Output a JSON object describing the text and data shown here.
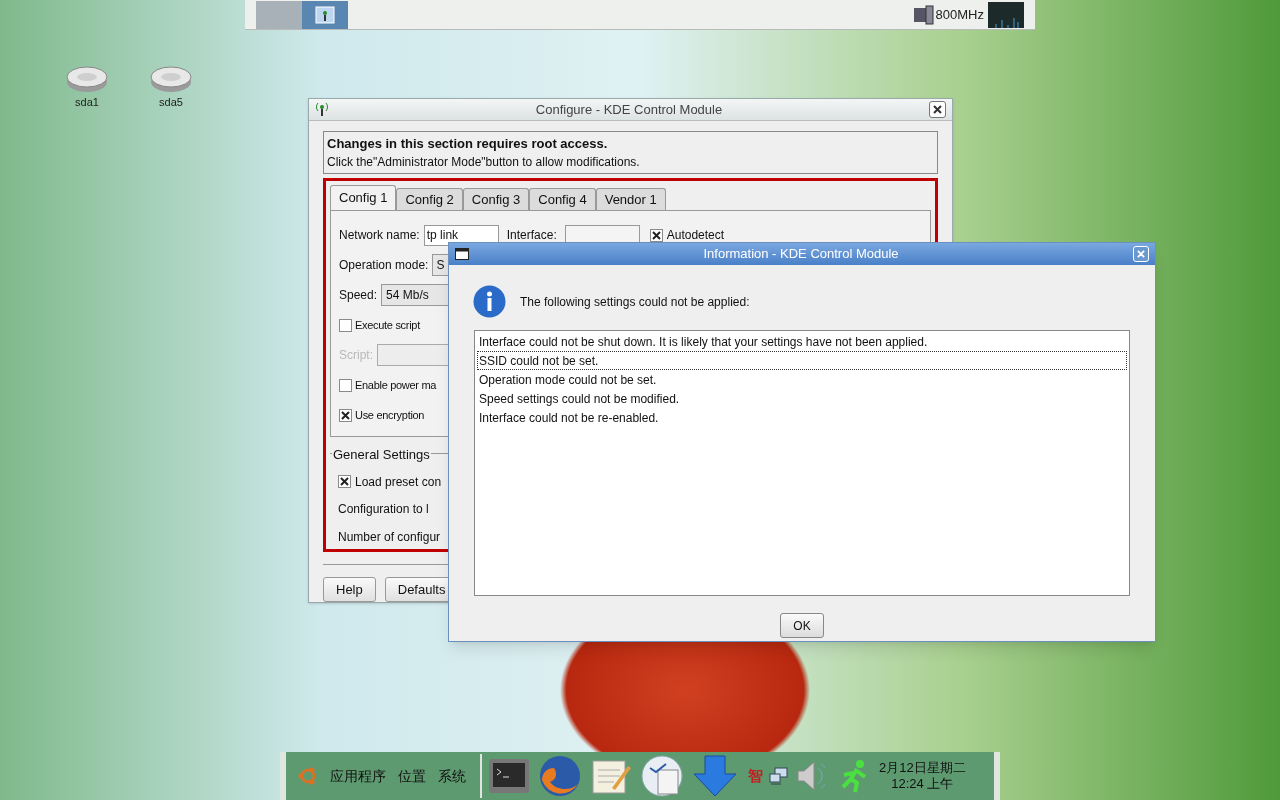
{
  "top_panel": {
    "workspaces": [
      {
        "selected": false
      },
      {
        "selected": true
      }
    ],
    "cpu_frequency": "800MHz"
  },
  "desktop_icons": [
    {
      "label": "sda1"
    },
    {
      "label": "sda5"
    }
  ],
  "config_window": {
    "title": "Configure - KDE Control Module",
    "notice": {
      "title": "Changes in this section requires root access.",
      "text": "Click the\"Administrator Mode\"button to allow modifications."
    },
    "tabs": [
      {
        "label": "Config 1",
        "selected": true
      },
      {
        "label": "Config 2",
        "selected": false
      },
      {
        "label": "Config 3",
        "selected": false
      },
      {
        "label": "Config 4",
        "selected": false
      },
      {
        "label": "Vendor 1",
        "selected": false
      }
    ],
    "network_name": {
      "label": "Network name:",
      "value": "tp link"
    },
    "interface": {
      "label": "Interface:"
    },
    "autodetect": {
      "label": "Autodetect",
      "checked": true
    },
    "operation_mode": {
      "label": "Operation mode:",
      "value": "S"
    },
    "speed": {
      "label": "Speed:",
      "value": "54 Mb/s"
    },
    "options": [
      {
        "kind": "checkbox",
        "label": "Execute script",
        "checked": false
      },
      {
        "kind": "script",
        "label": "Script:",
        "disabled": true
      },
      {
        "kind": "checkbox",
        "label": "Enable power ma",
        "checked": false
      },
      {
        "kind": "checkbox",
        "label": "Use encryption",
        "checked": true
      }
    ],
    "general_settings": {
      "title": "General Settings",
      "rows": [
        {
          "kind": "checkbox",
          "label": "Load preset con",
          "checked": true
        },
        {
          "kind": "text",
          "label": "Configuration to l"
        },
        {
          "kind": "text",
          "label": "Number of configur"
        }
      ]
    },
    "buttons": [
      "Help",
      "Defaults"
    ]
  },
  "info_dialog": {
    "title": "Information - KDE Control Module",
    "message": "The following settings could not be applied:",
    "items": [
      {
        "text": "Interface could not be shut down. It is likely that your settings have not been applied.",
        "selected": false
      },
      {
        "text": "SSID could not be set.",
        "selected": true
      },
      {
        "text": "Operation mode could not be set.",
        "selected": false
      },
      {
        "text": "Speed settings could not be modified.",
        "selected": false
      },
      {
        "text": "Interface could not be re-enabled.",
        "selected": false
      }
    ],
    "ok_button": "OK"
  },
  "bottom_panel": {
    "menus": [
      "应用程序",
      "位置",
      "系统"
    ],
    "input_method": "智",
    "clock": {
      "date": "2月12日星期二",
      "time": "12:24 上午"
    }
  }
}
